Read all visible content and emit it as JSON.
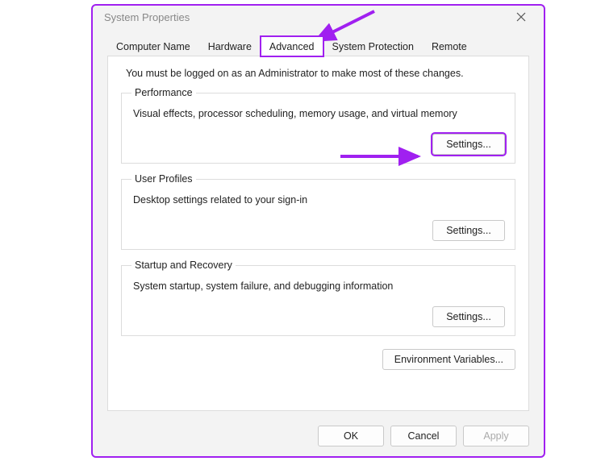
{
  "window": {
    "title": "System Properties"
  },
  "tabs": {
    "computer_name": "Computer Name",
    "hardware": "Hardware",
    "advanced": "Advanced",
    "system_protection": "System Protection",
    "remote": "Remote"
  },
  "intro": "You must be logged on as an Administrator to make most of these changes.",
  "performance": {
    "legend": "Performance",
    "desc": "Visual effects, processor scheduling, memory usage, and virtual memory",
    "settings_btn": "Settings..."
  },
  "user_profiles": {
    "legend": "User Profiles",
    "desc": "Desktop settings related to your sign-in",
    "settings_btn": "Settings..."
  },
  "startup": {
    "legend": "Startup and Recovery",
    "desc": "System startup, system failure, and debugging information",
    "settings_btn": "Settings..."
  },
  "env_vars_btn": "Environment Variables...",
  "footer": {
    "ok": "OK",
    "cancel": "Cancel",
    "apply": "Apply"
  },
  "annotations": {
    "accent": "#a020f0"
  }
}
